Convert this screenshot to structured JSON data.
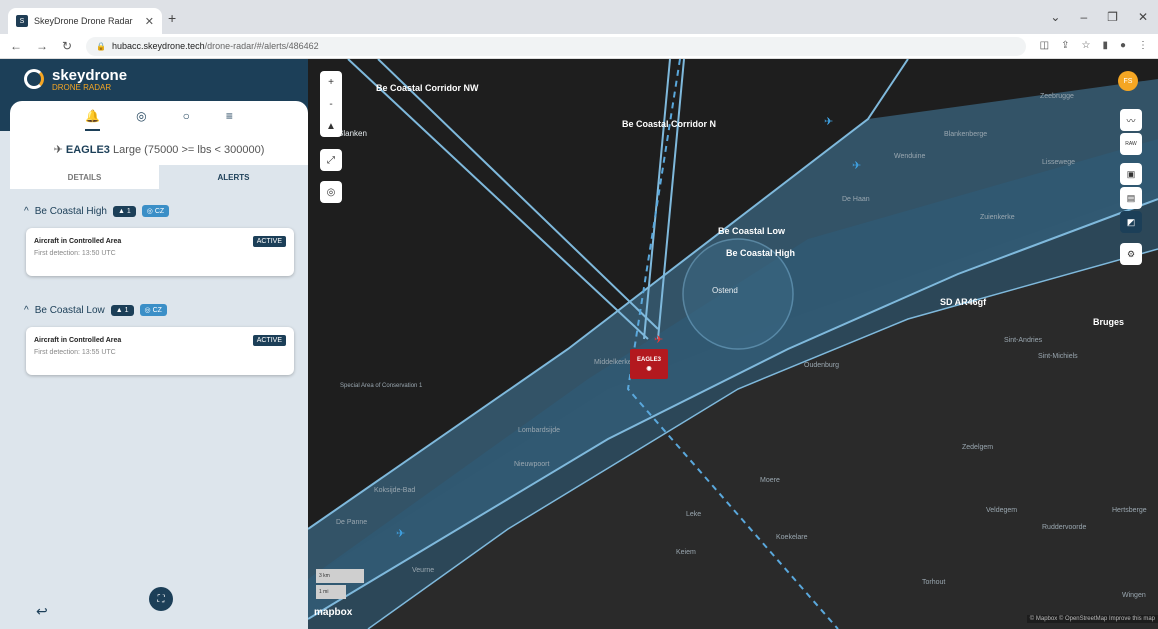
{
  "browser": {
    "tab_title": "SkeyDrone Drone Radar",
    "url_host": "hubacc.skeydrone.tech",
    "url_path": "/drone-radar/#/alerts/486462"
  },
  "brand": {
    "name": "skeydrone",
    "sub": "DRONE RADAR"
  },
  "aircraft": {
    "callsign": "EAGLE3",
    "category": "Large (75000 >= lbs < 300000)"
  },
  "tabs": {
    "details": "DETAILS",
    "alerts": "ALERTS"
  },
  "groups": [
    {
      "name": "Be Coastal High",
      "count": "1",
      "zone": "CZ",
      "alert": {
        "title": "Aircraft in Controlled Area",
        "detection": "First detection: 13:50 UTC",
        "status": "ACTIVE"
      }
    },
    {
      "name": "Be Coastal Low",
      "count": "1",
      "zone": "CZ",
      "alert": {
        "title": "Aircraft in Controlled Area",
        "detection": "First detection: 13:55 UTC",
        "status": "ACTIVE"
      }
    }
  ],
  "map": {
    "labels": {
      "corridor_nw": "Be Coastal Corridor NW",
      "corridor_n": "Be Coastal Corridor N",
      "coastal_low": "Be Coastal Low",
      "coastal_high": "Be Coastal High",
      "sd": "SD AR46gf",
      "ostend": "Ostend",
      "bruges": "Bruges",
      "blankenberge": "Blankenberge",
      "zeebrugge": "Zeebrugge",
      "wenduine": "Wenduine",
      "de_haan": "De Haan",
      "lissewege": "Lissewege",
      "zuienkerke": "Zuienkerke",
      "middelkerke": "Middelkerke",
      "oudenburg": "Oudenburg",
      "sint_andries": "Sint-Andries",
      "sint_michiels": "Sint-Michiels",
      "lombardsijde": "Lombardsijde",
      "nieuwpoort": "Nieuwpoort",
      "koksijde": "Koksijde-Bad",
      "de_panne": "De Panne",
      "veurne": "Veurne",
      "moere": "Moere",
      "leke": "Leke",
      "keiem": "Keiem",
      "koekelare": "Koekelare",
      "zedelgem": "Zedelgem",
      "veldegem": "Veldegem",
      "ruddervoorde": "Ruddervoorde",
      "torhout": "Torhout",
      "hertsberge": "Hertsberge",
      "wingene": "Wingen",
      "special_area": "Special Area of Conservation 1",
      "banken": "Blanken"
    },
    "marker": "EAGLE3",
    "avatar": "FS",
    "scale_km": "3 km",
    "scale_mi": "1 mi",
    "logo": "mapbox",
    "attribution": "© Mapbox © OpenStreetMap Improve this map"
  }
}
